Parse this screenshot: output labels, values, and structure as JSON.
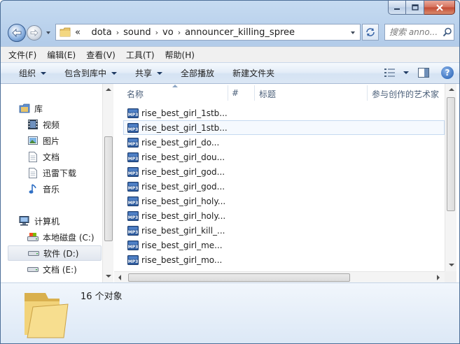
{
  "window": {
    "caption_buttons": [
      "minimize-icon",
      "maximize-icon",
      "close-icon"
    ]
  },
  "address": {
    "overflow": "«",
    "crumbs": [
      "dota",
      "sound",
      "vo",
      "announcer_killing_spree"
    ],
    "separator": "›"
  },
  "search": {
    "placeholder": "搜索 anno..."
  },
  "menu": {
    "items": [
      "文件(F)",
      "编辑(E)",
      "查看(V)",
      "工具(T)",
      "帮助(H)"
    ]
  },
  "commands": {
    "organize": "组织",
    "include_in_library": "包含到库中",
    "share": "共享",
    "play_all": "全部播放",
    "new_folder": "新建文件夹"
  },
  "nav": {
    "library": "库",
    "videos": "视频",
    "pictures": "图片",
    "documents": "文档",
    "xunlei": "迅雷下载",
    "music": "音乐",
    "computer": "计算机",
    "drive_c": "本地磁盘 (C:)",
    "drive_d": "软件 (D:)",
    "drive_e": "文档 (E:)"
  },
  "columns": {
    "name": "名称",
    "number": "#",
    "title": "标题",
    "contributing_artists": "参与创作的艺术家"
  },
  "files": [
    "rise_best_girl_1stb...",
    "rise_best_girl_1stb...",
    "rise_best_girl_do...",
    "rise_best_girl_dou...",
    "rise_best_girl_god...",
    "rise_best_girl_god...",
    "rise_best_girl_holy...",
    "rise_best_girl_holy...",
    "rise_best_girl_kill_...",
    "rise_best_girl_me...",
    "rise_best_girl_mo..."
  ],
  "details": {
    "item_count": "16 个对象"
  },
  "colors": {
    "accent": "#3f6fae",
    "selection": "#c5d9f1",
    "close": "#c24a33"
  }
}
